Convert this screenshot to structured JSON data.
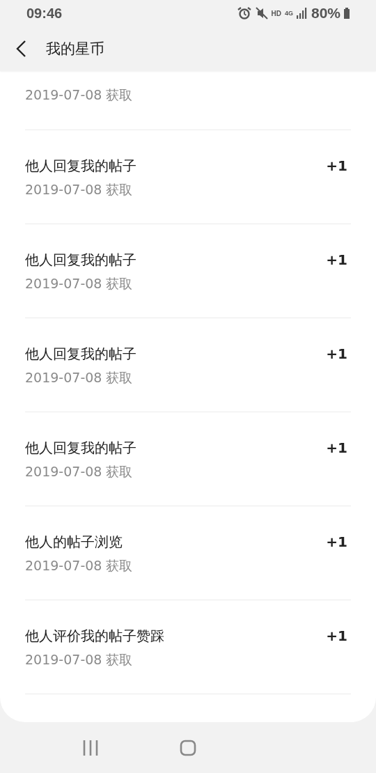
{
  "status_bar": {
    "time": "09:46",
    "hd": "HD",
    "network": "4G",
    "battery": "80%"
  },
  "header": {
    "title": "我的星币"
  },
  "records": [
    {
      "kind": "partial",
      "date": "2019-07-08 获取"
    },
    {
      "kind": "full",
      "title": "他人回复我的帖子",
      "amount": "+1",
      "date": "2019-07-08 获取"
    },
    {
      "kind": "full",
      "title": "他人回复我的帖子",
      "amount": "+1",
      "date": "2019-07-08 获取"
    },
    {
      "kind": "full",
      "title": "他人回复我的帖子",
      "amount": "+1",
      "date": "2019-07-08 获取"
    },
    {
      "kind": "full",
      "title": "他人回复我的帖子",
      "amount": "+1",
      "date": "2019-07-08 获取"
    },
    {
      "kind": "full",
      "title": "他人的帖子浏览",
      "amount": "+1",
      "date": "2019-07-08 获取"
    },
    {
      "kind": "full",
      "title": "他人评价我的帖子赞踩",
      "amount": "+1",
      "date": "2019-07-08 获取"
    }
  ]
}
